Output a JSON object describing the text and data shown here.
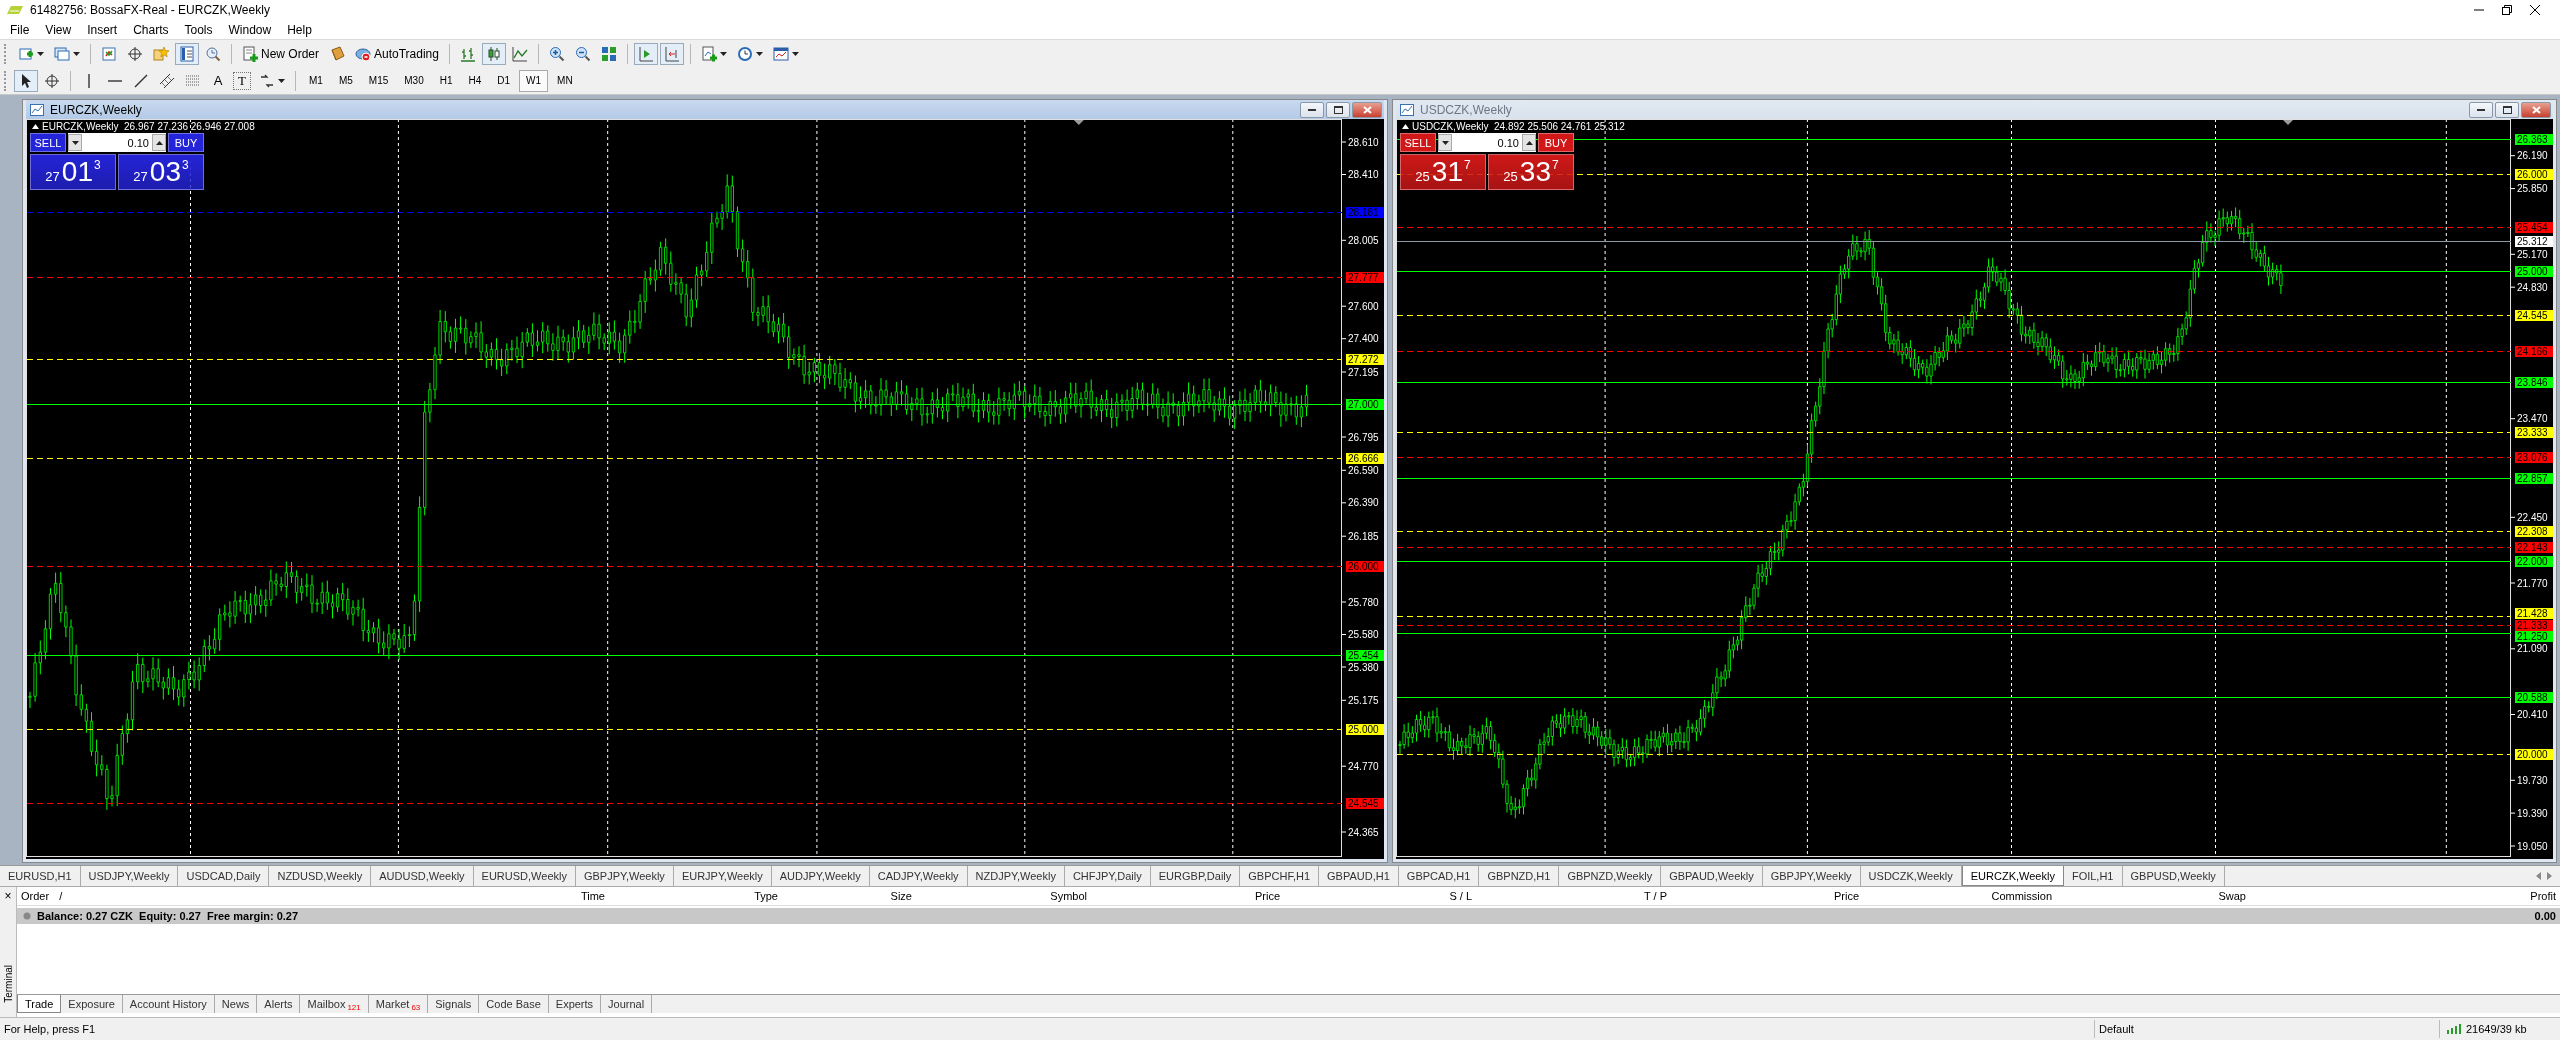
{
  "window": {
    "title": "61482756: BossaFX-Real - EURCZK,Weekly"
  },
  "menu": [
    "File",
    "View",
    "Insert",
    "Charts",
    "Tools",
    "Window",
    "Help"
  ],
  "toolbar": {
    "new_order": "New Order",
    "auto_trading": "AutoTrading",
    "text_tools": [
      "A",
      "T"
    ],
    "timeframes": [
      {
        "label": "M1",
        "selected": false
      },
      {
        "label": "M5",
        "selected": false
      },
      {
        "label": "M15",
        "selected": false
      },
      {
        "label": "M30",
        "selected": false
      },
      {
        "label": "H1",
        "selected": false
      },
      {
        "label": "H4",
        "selected": false
      },
      {
        "label": "D1",
        "selected": false
      },
      {
        "label": "W1",
        "selected": true
      },
      {
        "label": "MN",
        "selected": false
      }
    ]
  },
  "charts": [
    {
      "title": "EURCZK,Weekly",
      "active": true,
      "header": "EURCZK,Weekly  26.967 27.236 26.946 27.008",
      "trade_panel": {
        "color": "#2424d8",
        "sell": "SELL",
        "buy": "BUY",
        "lot": "0.10",
        "bid": {
          "big": "27",
          "main": "01",
          "small": "3"
        },
        "ask": {
          "big": "27",
          "main": "03",
          "small": "3"
        }
      },
      "price_ticks": [
        "28.610",
        "28.410",
        "28.005",
        "27.600",
        "27.400",
        "27.195",
        "26.795",
        "26.590",
        "26.390",
        "26.185",
        "25.780",
        "25.580",
        "25.380",
        "25.175",
        "24.770",
        "24.365"
      ],
      "levels": [
        {
          "price": "28.181",
          "color": "#0000ff",
          "kind": "dashed"
        },
        {
          "price": "27.777",
          "color": "#ff0000",
          "kind": "dashed"
        },
        {
          "price": "27.272",
          "color": "#ffff00",
          "kind": "dashed"
        },
        {
          "price": "27.000",
          "color": "#00ff00",
          "kind": "solid"
        },
        {
          "price": "26.666",
          "color": "#ffff00",
          "kind": "dashed"
        },
        {
          "price": "26.000",
          "color": "#ff0000",
          "kind": "dashed"
        },
        {
          "price": "25.454",
          "color": "#00ff00",
          "kind": "solid"
        },
        {
          "price": "25.000",
          "color": "#ffff00",
          "kind": "dashed"
        },
        {
          "price": "24.545",
          "color": "#ff0000",
          "kind": "dashed"
        }
      ]
    },
    {
      "title": "USDCZK,Weekly",
      "active": false,
      "header": "USDCZK,Weekly  24.892 25.506 24.761 25.312",
      "trade_panel": {
        "color": "#d01818",
        "sell": "SELL",
        "buy": "BUY",
        "lot": "0.10",
        "bid": {
          "big": "25",
          "main": "31",
          "small": "7"
        },
        "ask": {
          "big": "25",
          "main": "33",
          "small": "7"
        }
      },
      "price_ticks": [
        "26.190",
        "25.850",
        "25.170",
        "24.830",
        "23.470",
        "22.450",
        "21.770",
        "21.090",
        "20.410",
        "19.730",
        "19.390",
        "19.050"
      ],
      "levels": [
        {
          "price": "26.363",
          "color": "#00ff00",
          "kind": "solid"
        },
        {
          "price": "26.000",
          "color": "#ffff00",
          "kind": "dashed"
        },
        {
          "price": "25.454",
          "color": "#ff0000",
          "kind": "dashed"
        },
        {
          "price": "25.312",
          "color": "#ffffff",
          "kind": "current"
        },
        {
          "price": "25.000",
          "color": "#00ff00",
          "kind": "solid"
        },
        {
          "price": "24.545",
          "color": "#ffff00",
          "kind": "dashed"
        },
        {
          "price": "24.166",
          "color": "#ff0000",
          "kind": "dashed"
        },
        {
          "price": "23.846",
          "color": "#00ff00",
          "kind": "solid"
        },
        {
          "price": "23.333",
          "color": "#ffff00",
          "kind": "dashed"
        },
        {
          "price": "23.076",
          "color": "#ff0000",
          "kind": "dashed"
        },
        {
          "price": "22.857",
          "color": "#00ff00",
          "kind": "solid"
        },
        {
          "price": "22.308",
          "color": "#ffff00",
          "kind": "dashed"
        },
        {
          "price": "22.143",
          "color": "#ff0000",
          "kind": "dashed"
        },
        {
          "price": "22.000",
          "color": "#00ff00",
          "kind": "solid"
        },
        {
          "price": "21.428",
          "color": "#ffff00",
          "kind": "dashed"
        },
        {
          "price": "21.333",
          "color": "#ff0000",
          "kind": "dashed"
        },
        {
          "price": "21.250",
          "color": "#00ff00",
          "kind": "solid"
        },
        {
          "price": "20.588",
          "color": "#00ff00",
          "kind": "solid"
        },
        {
          "price": "20.000",
          "color": "#ffff00",
          "kind": "dashed"
        }
      ]
    }
  ],
  "chart_tabs": [
    {
      "label": "EURUSD,H1",
      "selected": false
    },
    {
      "label": "USDJPY,Weekly",
      "selected": false
    },
    {
      "label": "USDCAD,Daily",
      "selected": false
    },
    {
      "label": "NZDUSD,Weekly",
      "selected": false
    },
    {
      "label": "AUDUSD,Weekly",
      "selected": false
    },
    {
      "label": "EURUSD,Weekly",
      "selected": false
    },
    {
      "label": "GBPJPY,Weekly",
      "selected": false
    },
    {
      "label": "EURJPY,Weekly",
      "selected": false
    },
    {
      "label": "AUDJPY,Weekly",
      "selected": false
    },
    {
      "label": "CADJPY,Weekly",
      "selected": false
    },
    {
      "label": "NZDJPY,Weekly",
      "selected": false
    },
    {
      "label": "CHFJPY,Daily",
      "selected": false
    },
    {
      "label": "EURGBP,Daily",
      "selected": false
    },
    {
      "label": "GBPCHF,H1",
      "selected": false
    },
    {
      "label": "GBPAUD,H1",
      "selected": false
    },
    {
      "label": "GBPCAD,H1",
      "selected": false
    },
    {
      "label": "GBPNZD,H1",
      "selected": false
    },
    {
      "label": "GBPNZD,Weekly",
      "selected": false
    },
    {
      "label": "GBPAUD,Weekly",
      "selected": false
    },
    {
      "label": "GBPJPY,Weekly",
      "selected": false
    },
    {
      "label": "USDCZK,Weekly",
      "selected": false
    },
    {
      "label": "EURCZK,Weekly",
      "selected": true
    },
    {
      "label": "FOIL,H1",
      "selected": false
    },
    {
      "label": "GBPUSD,Weekly",
      "selected": false
    }
  ],
  "terminal": {
    "label": "Terminal",
    "close": "×",
    "columns": [
      {
        "label": "Order",
        "sort_mark": "/"
      },
      {
        "label": "Time"
      },
      {
        "label": "Type"
      },
      {
        "label": "Size"
      },
      {
        "label": "Symbol"
      },
      {
        "label": "Price"
      },
      {
        "label": "S / L"
      },
      {
        "label": "T / P"
      },
      {
        "label": "Price"
      },
      {
        "label": "Commission"
      },
      {
        "label": "Swap"
      },
      {
        "label": "Profit"
      }
    ],
    "balance_row": {
      "text": "Balance: 0.27 CZK  Equity: 0.27  Free margin: 0.27",
      "profit": "0.00"
    },
    "tabs": [
      {
        "label": "Trade",
        "selected": true
      },
      {
        "label": "Exposure",
        "selected": false
      },
      {
        "label": "Account History",
        "selected": false
      },
      {
        "label": "News",
        "selected": false
      },
      {
        "label": "Alerts",
        "selected": false
      },
      {
        "label": "Mailbox",
        "badge": "121",
        "selected": false
      },
      {
        "label": "Market",
        "badge": "63",
        "selected": false
      },
      {
        "label": "Signals",
        "selected": false
      },
      {
        "label": "Code Base",
        "selected": false
      },
      {
        "label": "Experts",
        "selected": false
      },
      {
        "label": "Journal",
        "selected": false
      }
    ]
  },
  "status_bar": {
    "help": "For Help, press F1",
    "profile": "Default",
    "traffic": "21649/39 kb"
  }
}
